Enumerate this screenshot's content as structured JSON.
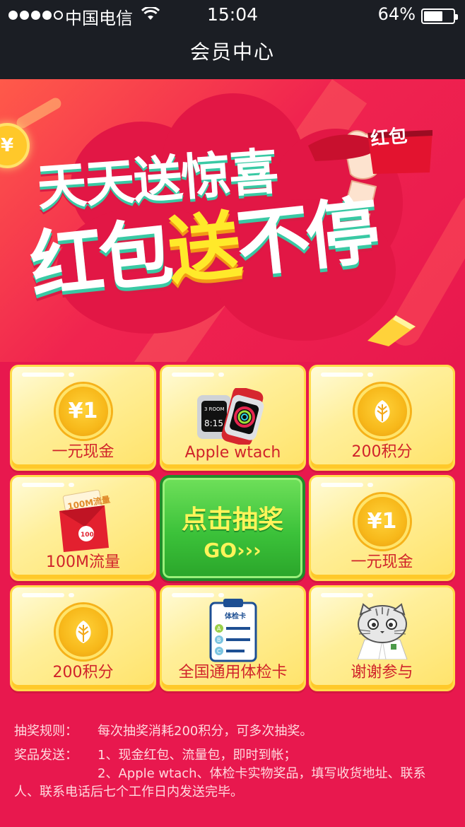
{
  "status_bar": {
    "carrier": "中国电信",
    "time": "15:04",
    "battery": "64%"
  },
  "nav": {
    "title": "会员中心"
  },
  "banner": {
    "line1": "天天送惊喜",
    "line2_a": "红包",
    "line2_b": "送",
    "line2_c": "不停",
    "flag_text": "红包",
    "coin_symbol": "¥"
  },
  "prizes": [
    {
      "label": "一元现金",
      "icon": "cash-coin-icon",
      "coin_text": "¥1"
    },
    {
      "label": "Apple wtach",
      "icon": "apple-watch-icon"
    },
    {
      "label": "200积分",
      "icon": "points-coin-icon"
    },
    {
      "label": "100M流量",
      "icon": "data-envelope-icon",
      "envelope_text": "100M流量",
      "badge": "100"
    },
    {
      "label": "一元现金",
      "icon": "cash-coin-icon",
      "coin_text": "¥1"
    },
    {
      "label": "200积分",
      "icon": "points-coin-icon"
    },
    {
      "label": "全国通用体检卡",
      "icon": "checkup-card-icon",
      "card_title": "体检卡"
    },
    {
      "label": "谢谢参与",
      "icon": "cat-doctor-icon"
    }
  ],
  "draw_button": {
    "title": "点击抽奖",
    "sub": "GO›››"
  },
  "rules": {
    "rule_key": "抽奖规则：",
    "rule_text": "每次抽奖消耗200积分，可多次抽奖。",
    "delivery_key": "奖品发送：",
    "delivery_lines": [
      "1、现金红包、流量包，即时到帐；",
      "2、Apple wtach、体检卡实物奖品，填写收货地址、联系",
      "人、联系电话后七个工作日内发送完毕。"
    ]
  },
  "colors": {
    "page_bg": "#e8184e",
    "topbar": "#1b1e24",
    "cell_yellow": "#ffef9a",
    "go_green": "#3cc23a",
    "label_red": "#d0232a"
  }
}
